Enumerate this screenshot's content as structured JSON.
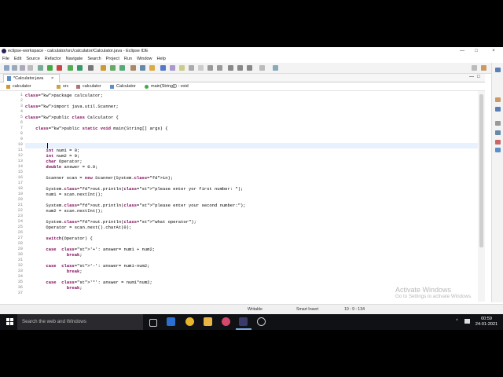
{
  "window": {
    "title": "eclipse-workspace - calculator/src/calculator/Calculator.java - Eclipse IDE",
    "minimize": "—",
    "maximize": "□",
    "close": "×"
  },
  "menu": [
    "File",
    "Edit",
    "Source",
    "Refactor",
    "Navigate",
    "Search",
    "Project",
    "Run",
    "Window",
    "Help"
  ],
  "editor": {
    "tab_label": "*Calculator.java",
    "tab_close": "×",
    "breadcrumb": [
      "calculator",
      "src",
      "calculator",
      "Calculator",
      "main(String[]) : void"
    ]
  },
  "code": {
    "line_numbers": [
      "1",
      "2",
      "3",
      "4",
      "5",
      "6",
      "7",
      "8",
      "9",
      "10",
      "11",
      "12",
      "13",
      "14",
      "15",
      "16",
      "17",
      "18",
      "19",
      "20",
      "21",
      "22",
      "23",
      "24",
      "25",
      "26",
      "27",
      "28",
      "29",
      "30",
      "31",
      "32",
      "33",
      "34",
      "35",
      "36",
      "37"
    ],
    "lines": [
      "package calculator;",
      "",
      "import java.util.Scanner;",
      "",
      "public class Calculator {",
      "",
      "    public static void main(String[] args) {",
      "",
      "",
      "        ",
      "        int num1 = 0;",
      "        int num2 = 0;",
      "        char Operator;",
      "        double answer = 0.0;",
      "",
      "        Scanner scan = new Scanner(System.in);",
      "",
      "        System.out.println(\"please enter yor first number: \");",
      "        num1 = scan.nextInt();",
      "",
      "        System.out.println(\"please enter your second number:\");",
      "        num2 = scan.nextInt();",
      "",
      "        System.out.println(\"what operator\");",
      "        Operator = scan.next().charAt(0);",
      "",
      "        switch(Operator) {",
      "",
      "        case  '+': answer= num1 + num2;",
      "                break;",
      "",
      "        case  '-': answer= num1-num2;",
      "                break;",
      "",
      "        case  '*': answer = num1*num2;",
      "                break;",
      ""
    ]
  },
  "status": {
    "mode": "Writable",
    "insert": "Smart Insert",
    "position": "10 : 9 : 134"
  },
  "activate": {
    "title": "Activate Windows",
    "subtitle": "Go to Settings to activate Windows."
  },
  "taskbar": {
    "search_placeholder": "Search the web and Windows",
    "time": "00:59",
    "date": "24-01-2021"
  }
}
